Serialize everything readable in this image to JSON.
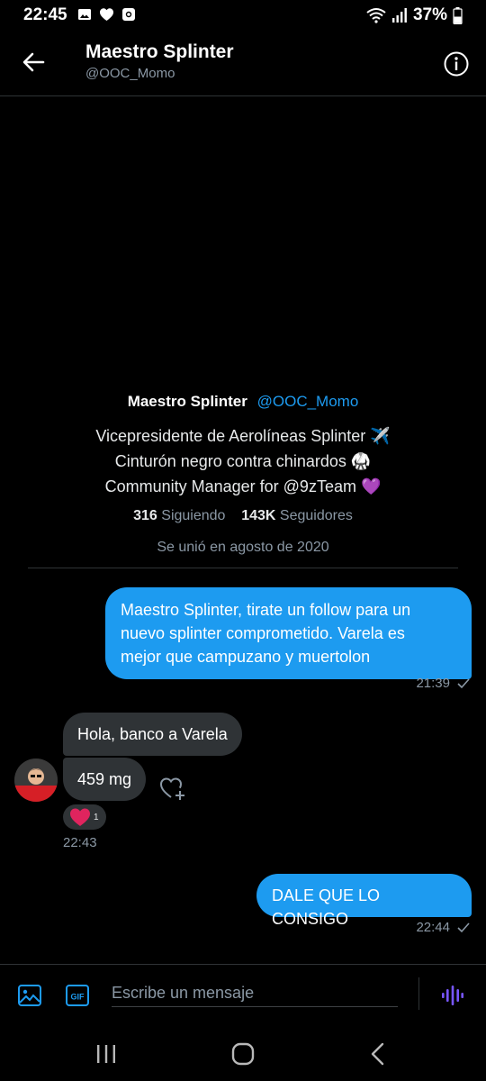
{
  "status_bar": {
    "time": "22:45",
    "battery": "37%",
    "icons_left": [
      "image-icon",
      "heart-icon",
      "instagram-icon"
    ],
    "icons_right": [
      "wifi-icon",
      "signal-icon",
      "battery-icon"
    ]
  },
  "header": {
    "title": "Maestro Splinter",
    "handle": "@OOC_Momo",
    "back_icon": "back-arrow-icon",
    "info_icon": "info-icon"
  },
  "profile": {
    "name": "Maestro Splinter",
    "handle": "@OOC_Momo",
    "bio": [
      "Vicepresidente de Aerolíneas Splinter ✈️",
      "Cinturón negro contra chinardos 🥋",
      "Community Manager for @9zTeam 💜"
    ],
    "following_count": "316",
    "following_label": "Siguiendo",
    "followers_count": "143K",
    "followers_label": "Seguidores",
    "joined": "Se unió en agosto de 2020"
  },
  "messages": [
    {
      "direction": "out",
      "text_lines": [
        "Maestro Splinter, tirate un follow para un",
        "nuevo splinter comprometido. Varela es",
        "mejor que campuzano y muertolon"
      ],
      "time": "21:39"
    },
    {
      "direction": "in",
      "parts": [
        "Hola, banco a Varela",
        "459 mg"
      ],
      "reaction": "❤️",
      "reaction_count": "1",
      "time": "22:43"
    },
    {
      "direction": "out",
      "text_lines": [
        "DALE QUE LO CONSIGO"
      ],
      "time": "22:44"
    }
  ],
  "composer": {
    "placeholder": "Escribe un mensaje",
    "gif_label": "GIF"
  },
  "colors": {
    "accent": "#1d9bf0",
    "background": "#000000",
    "incoming_bubble": "#2f3336",
    "muted": "#8b98a5",
    "voice": "#7856ff"
  }
}
